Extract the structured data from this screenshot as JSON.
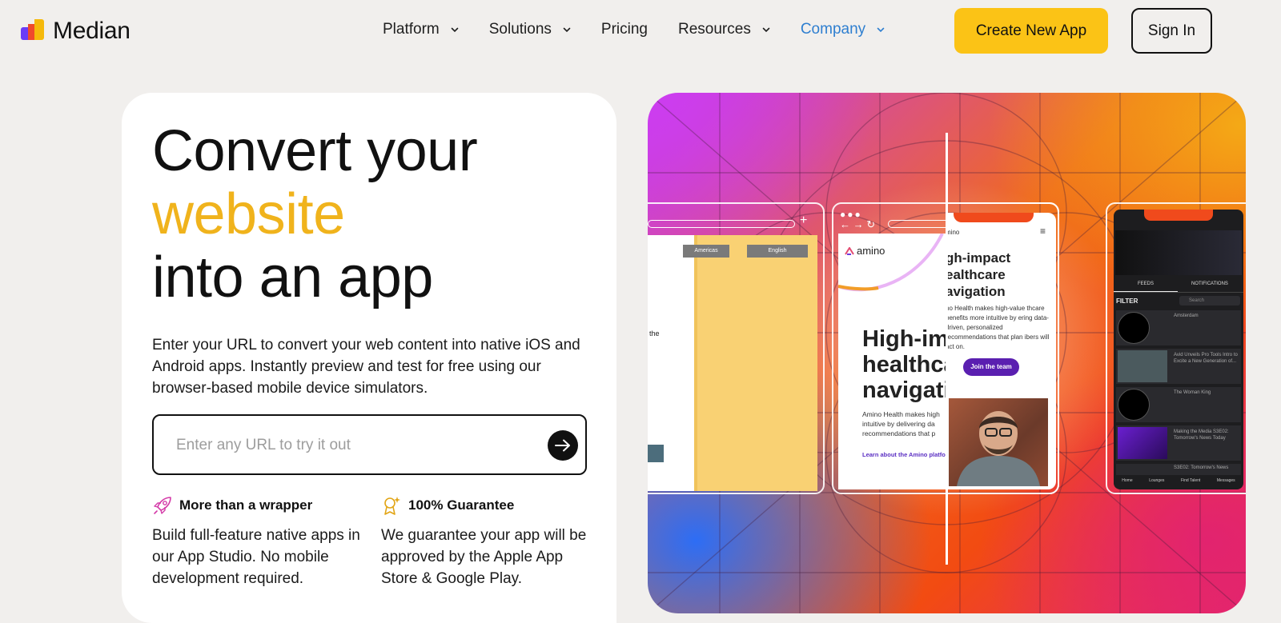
{
  "brand": {
    "name": "Median",
    "colors": {
      "accent": "#fbc316",
      "link_active": "#2f7fd0",
      "headline_accent": "#f0b31c"
    }
  },
  "nav": {
    "items": [
      {
        "label": "Platform",
        "has_dropdown": true
      },
      {
        "label": "Solutions",
        "has_dropdown": true
      },
      {
        "label": "Pricing",
        "has_dropdown": false
      },
      {
        "label": "Resources",
        "has_dropdown": true
      },
      {
        "label": "Company",
        "has_dropdown": true,
        "active": true
      }
    ],
    "create_app_label": "Create New App",
    "sign_in_label": "Sign In"
  },
  "hero": {
    "headline_line1": "Convert your",
    "headline_accent": "website",
    "headline_line3": "into an app",
    "subcopy": "Enter your URL to convert your web content into native iOS and Android apps. Instantly preview and test for free using our browser-based mobile device simulators.",
    "url_placeholder": "Enter any URL to try it out",
    "features": [
      {
        "icon": "rocket-icon",
        "title": "More than a wrapper",
        "body": "Build full-feature native apps in our App Studio. No mobile development required."
      },
      {
        "icon": "award-icon",
        "title": "100% Guarantee",
        "body": "We guarantee your app will be approved by the Apple App Store & Google Play."
      }
    ]
  },
  "visual": {
    "left_browser": {
      "language_button_1": "Americas",
      "language_button_2": "English",
      "fragment_text": "the"
    },
    "middle_browser": {
      "logo_text": "amino",
      "heading": "High-im healthca navigati",
      "body": "Amino Health makes high intuitive by delivering da recommendations that p",
      "link": "Learn about the Amino platfo"
    },
    "middle_phone": {
      "logo_text": "mino",
      "heading": "gh-impact ealthcare avigation",
      "body": "no Health makes high-value thcare benefits more intuitive by ering data-driven, personalized recommendations that plan ibers will act on.",
      "cta": "Join the team"
    },
    "right_phone": {
      "tabs": [
        "FEEDS",
        "NOTIFICATIONS"
      ],
      "filter_label": "FILTER",
      "search_placeholder": "Search",
      "list_items": [
        "Amsterdam",
        "Avid Unveils Pro Tools Intro to Excite a New Generation of...",
        "The Woman King",
        "Making the Media S3E02: Tomorrow's News Today",
        "S3E02: Tomorrow's News"
      ],
      "bottom_nav": [
        "Home",
        "Lounges",
        "Find Talent",
        "Messages"
      ]
    }
  }
}
